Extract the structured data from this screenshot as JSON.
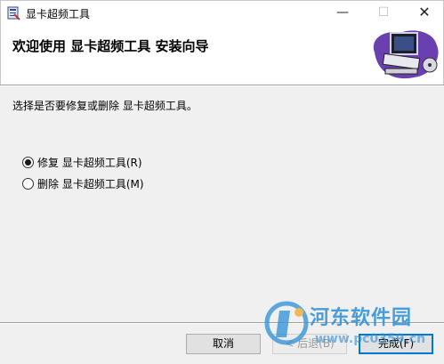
{
  "window": {
    "title": "显卡超频工具",
    "minimize_glyph": "—",
    "maximize_glyph": "☐",
    "close_glyph": "✕"
  },
  "banner": {
    "heading": "欢迎使用  显卡超频工具  安装向导"
  },
  "main": {
    "instruction": "选择是否要修复或删除 显卡超频工具。",
    "options": [
      {
        "label": "修复 显卡超频工具(R)",
        "selected": true
      },
      {
        "label": "删除 显卡超频工具(M)",
        "selected": false
      }
    ]
  },
  "buttons": {
    "cancel": "取消",
    "back": "< 后退(B)",
    "finish": "完成(F)"
  },
  "watermark": {
    "text": "河东软件园",
    "url": "www.pc0359.cn"
  },
  "colors": {
    "accent": "#0078d7",
    "watermark": "#2b8fd6"
  },
  "icons": [
    "installer-icon",
    "computer-illustration",
    "radio-selected-icon",
    "radio-empty-icon",
    "watermark-logo"
  ]
}
